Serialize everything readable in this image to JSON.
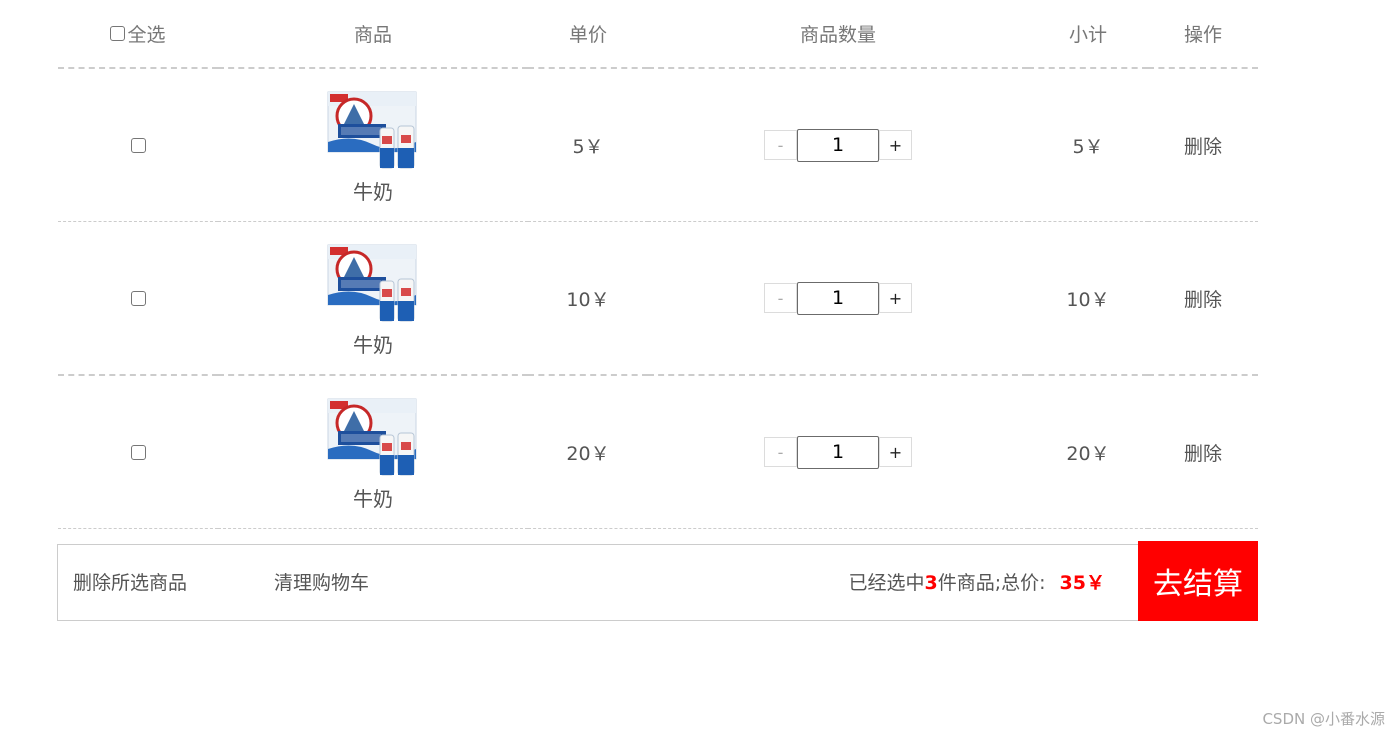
{
  "header": {
    "select_all": "全选",
    "goods": "商品",
    "unit_price": "单价",
    "quantity": "商品数量",
    "subtotal": "小计",
    "operation": "操作"
  },
  "rows": [
    {
      "name": "牛奶",
      "price": "5￥",
      "qty": "1",
      "subtotal": "5￥",
      "delete": "删除",
      "minus": "-",
      "plus": "+"
    },
    {
      "name": "牛奶",
      "price": "10￥",
      "qty": "1",
      "subtotal": "10￥",
      "delete": "删除",
      "minus": "-",
      "plus": "+"
    },
    {
      "name": "牛奶",
      "price": "20￥",
      "qty": "1",
      "subtotal": "20￥",
      "delete": "删除",
      "minus": "-",
      "plus": "+"
    }
  ],
  "footer": {
    "delete_selected": "删除所选商品",
    "clear_cart": "清理购物车",
    "selected_prefix": "已经选中",
    "selected_count": "3",
    "selected_suffix": "件商品;总价:",
    "total": "35￥",
    "checkout": "去结算"
  },
  "watermark": "CSDN @小番水源",
  "colors": {
    "accent": "#ff0000",
    "border": "#cccccc",
    "text": "#555555"
  },
  "icons": {
    "product_image": "milk-box-image"
  }
}
